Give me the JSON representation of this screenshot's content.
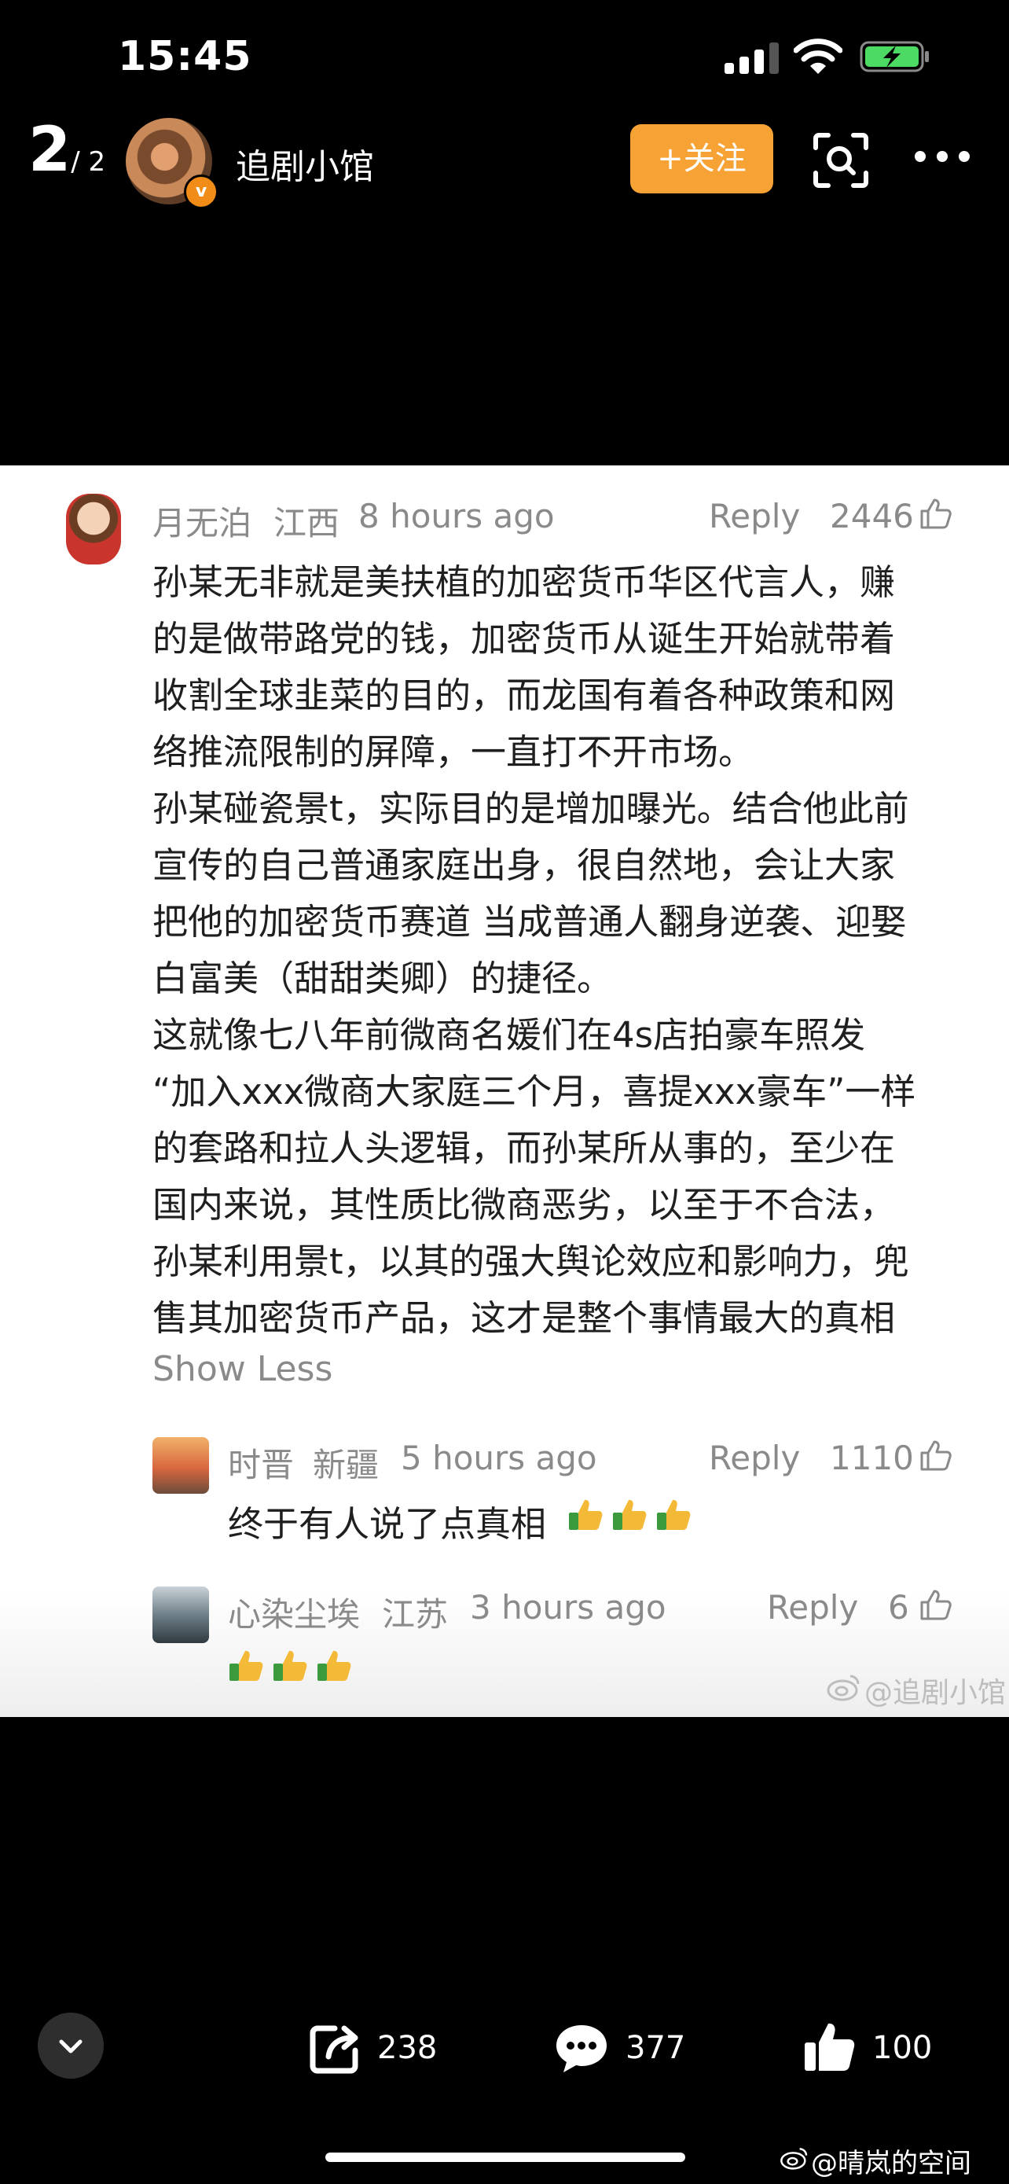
{
  "status_bar": {
    "time": "15:45"
  },
  "header": {
    "pager_current": "2",
    "pager_total": "/ 2",
    "account_name": "追剧小馆",
    "follow_label": "+关注"
  },
  "comments": [
    {
      "user": "月无泊",
      "region": "江西",
      "time": "8 hours ago",
      "reply_label": "Reply",
      "likes": "2446",
      "lines": [
        "孙某无非就是美扶植的加密货币华区代言人，赚",
        "的是做带路党的钱，加密货币从诞生开始就带着",
        "收割全球韭菜的目的，而龙国有着各种政策和网",
        "络推流限制的屏障，一直打不开市场。",
        "孙某碰瓷景t，实际目的是增加曝光。结合他此前",
        "宣传的自己普通家庭出身，很自然地，会让大家",
        "把他的加密货币赛道 当成普通人翻身逆袭、迎娶",
        "白富美（甜甜类卿）的捷径。",
        "这就像七八年前微商名媛们在4s店拍豪车照发",
        "“加入xxx微商大家庭三个月，喜提xxx豪车”一样",
        "的套路和拉人头逻辑，而孙某所从事的，至少在",
        "国内来说，其性质比微商恶劣，以至于不合法，",
        "孙某利用景t，以其的强大舆论效应和影响力，兜",
        "售其加密货币产品，这才是整个事情最大的真相"
      ],
      "show_less": "Show Less"
    },
    {
      "user": "时晋",
      "region": "新疆",
      "time": "5 hours ago",
      "reply_label": "Reply",
      "likes": "1110",
      "text": "终于有人说了点真相"
    },
    {
      "user": "心染尘埃",
      "region": "江苏",
      "time": "3 hours ago",
      "reply_label": "Reply",
      "likes": "6"
    }
  ],
  "watermark": "@追剧小馆",
  "bottom_bar": {
    "share_count": "238",
    "comment_count": "377",
    "like_count": "100"
  },
  "repost_watermark": "@晴岚的空间",
  "icons": [
    "signal-icon",
    "wifi-icon",
    "battery-charging-icon",
    "verified-badge-icon",
    "scan-icon",
    "more-icon",
    "thumb-up-icon",
    "thumbs-up-emoji-icon",
    "collapse-chevron-icon",
    "share-icon",
    "comment-icon",
    "like-icon",
    "weibo-logo-icon"
  ],
  "colors": {
    "follow_button": "#f7a234",
    "panel_bg": "#ffffff",
    "meta_text": "#8a8a8a",
    "body_text": "#1f1f1f"
  }
}
